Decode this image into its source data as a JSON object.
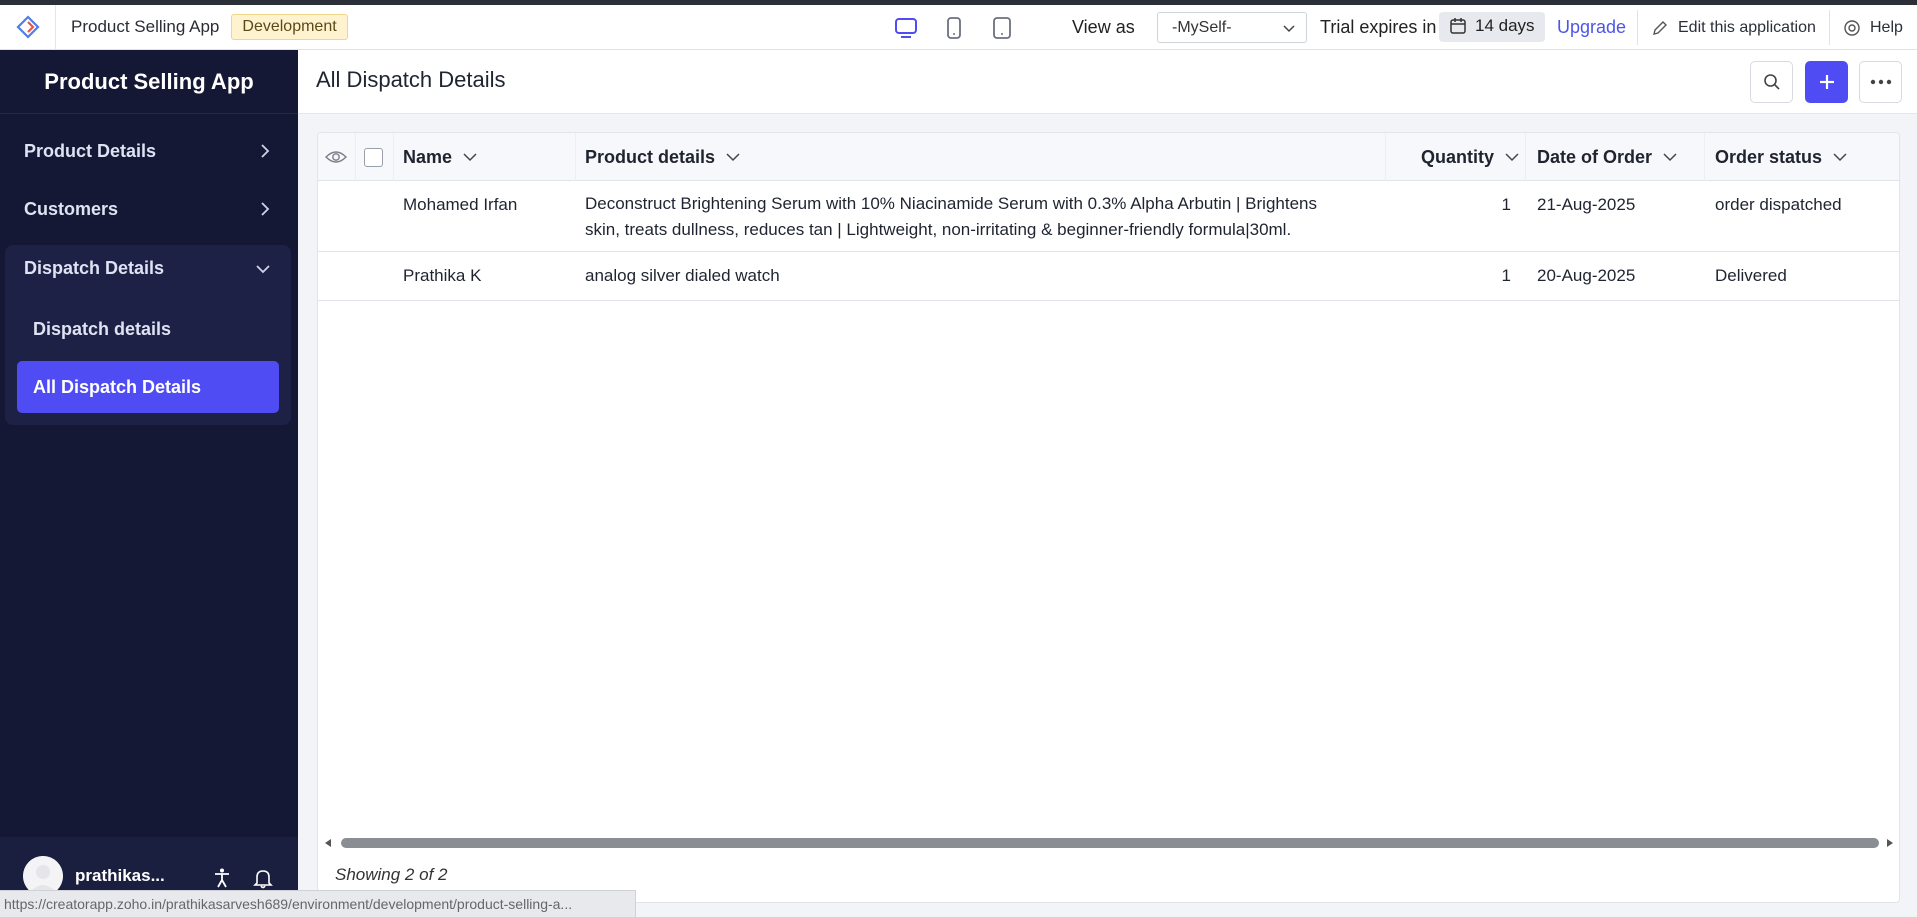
{
  "topbar": {
    "app_name": "Product Selling App",
    "env_badge": "Development",
    "view_as_label": "View as",
    "view_as_value": "-MySelf-",
    "trial_label": "Trial expires in",
    "trial_days": "14 days",
    "upgrade_label": "Upgrade",
    "edit_label": "Edit this application",
    "help_label": "Help",
    "device_icons": [
      "desktop-icon",
      "phone-icon",
      "tablet-icon"
    ],
    "active_device": "desktop"
  },
  "sidebar": {
    "title": "Product Selling App",
    "items": [
      {
        "label": "Product Details",
        "icon": "chevron-right-icon"
      },
      {
        "label": "Customers",
        "icon": "chevron-right-icon"
      }
    ],
    "group": {
      "label": "Dispatch Details",
      "icon": "chevron-down-icon",
      "children": [
        {
          "label": "Dispatch details",
          "active": false
        },
        {
          "label": "All Dispatch Details",
          "active": true
        }
      ]
    },
    "user_name": "prathikas..."
  },
  "main": {
    "page_title": "All Dispatch Details",
    "columns": [
      "Name",
      "Product details",
      "Quantity",
      "Date of Order",
      "Order status"
    ],
    "rows": [
      {
        "name": "Mohamed Irfan",
        "product_line1": "Deconstruct Brightening Serum with 10% Niacinamide Serum with 0.3% Alpha Arbutin | Brightens",
        "product_line2": "skin, treats dullness, reduces tan | Lightweight, non-irritating & beginner-friendly formula|30ml.",
        "quantity": "1",
        "date": "21-Aug-2025",
        "status": "order dispatched"
      },
      {
        "name": "Prathika K",
        "product_line1": "analog silver dialed watch",
        "product_line2": "",
        "quantity": "1",
        "date": "20-Aug-2025",
        "status": "Delivered"
      }
    ],
    "showing": "Showing 2 of 2"
  },
  "status_bar_url": "https://creatorapp.zoho.in/prathikasarvesh689/environment/development/product-selling-a...",
  "colors": {
    "accent": "#4f4cf3",
    "sidebar_bg": "#151835",
    "upgrade": "#4d55e8",
    "badge_bg": "#fff3cf"
  }
}
